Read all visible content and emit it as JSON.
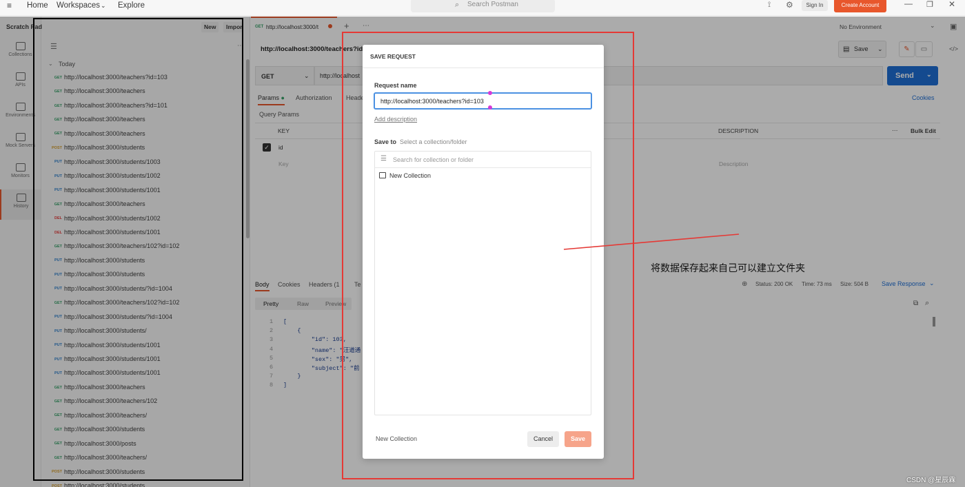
{
  "topbar": {
    "home": "Home",
    "workspaces": "Workspaces",
    "explore": "Explore",
    "search_placeholder": "Search Postman",
    "sign_in": "Sign In",
    "create_account": "Create Account"
  },
  "rail": [
    "Collections",
    "APIs",
    "Environments",
    "Mock Servers",
    "Monitors",
    "History"
  ],
  "sidebar": {
    "title": "Scratch Pad",
    "new_label": "New",
    "import_label": "Impor",
    "group_label": "Today",
    "history": [
      {
        "method": "GET",
        "url": "http://localhost:3000/teachers?id=103"
      },
      {
        "method": "GET",
        "url": "http://localhost:3000/teachers"
      },
      {
        "method": "GET",
        "url": "http://localhost:3000/teachers?id=101"
      },
      {
        "method": "GET",
        "url": "http://localhost:3000/teachers"
      },
      {
        "method": "GET",
        "url": "http://localhost:3000/teachers"
      },
      {
        "method": "POST",
        "url": "http://localhost:3000/students"
      },
      {
        "method": "PUT",
        "url": "http://localhost:3000/students/1003"
      },
      {
        "method": "PUT",
        "url": "http://localhost:3000/students/1002"
      },
      {
        "method": "PUT",
        "url": "http://localhost:3000/students/1001"
      },
      {
        "method": "GET",
        "url": "http://localhost:3000/teachers"
      },
      {
        "method": "DEL",
        "url": "http://localhost:3000/students/1002"
      },
      {
        "method": "DEL",
        "url": "http://localhost:3000/students/1001"
      },
      {
        "method": "GET",
        "url": "http://localhost:3000/teachers/102?id=102"
      },
      {
        "method": "PUT",
        "url": "http://localhost:3000/students"
      },
      {
        "method": "PUT",
        "url": "http://localhost:3000/students"
      },
      {
        "method": "PUT",
        "url": "http://localhost:3000/students/?id=1004"
      },
      {
        "method": "GET",
        "url": "http://localhost:3000/teachers/102?id=102"
      },
      {
        "method": "PUT",
        "url": "http://localhost:3000/students/?id=1004"
      },
      {
        "method": "PUT",
        "url": "http://localhost:3000/students/"
      },
      {
        "method": "PUT",
        "url": "http://localhost:3000/students/1001"
      },
      {
        "method": "PUT",
        "url": "http://localhost:3000/students/1001"
      },
      {
        "method": "PUT",
        "url": "http://localhost:3000/students/1001"
      },
      {
        "method": "GET",
        "url": "http://localhost:3000/teachers"
      },
      {
        "method": "GET",
        "url": "http://localhost:3000/teachers/102"
      },
      {
        "method": "GET",
        "url": "http://localhost:3000/teachers/"
      },
      {
        "method": "GET",
        "url": "http://localhost:3000/students"
      },
      {
        "method": "GET",
        "url": "http://localhost:3000/posts"
      },
      {
        "method": "GET",
        "url": "http://localhost:3000/teachers/"
      },
      {
        "method": "POST",
        "url": "http://localhost:3000/students"
      },
      {
        "method": "POST",
        "url": "http://localhost:3000/students"
      }
    ]
  },
  "main": {
    "tab_method": "GET",
    "tab_label": "http://localhost:3000/t",
    "environment": "No Environment",
    "request_title": "http://localhost:3000/teachers?id",
    "save_label": "Save",
    "method": "GET",
    "url_value": "http://localhost",
    "send_label": "Send",
    "req_tabs": [
      "Params",
      "Authorization",
      "Heade"
    ],
    "cookies": "Cookies",
    "query_params": "Query Params",
    "col_key": "KEY",
    "col_description": "DESCRIPTION",
    "bulk_edit": "Bulk Edit",
    "row_key": "id",
    "key_placeholder": "Key",
    "desc_placeholder": "Description",
    "resp_tabs": [
      "Body",
      "Cookies",
      "Headers (1",
      "Te"
    ],
    "status": "Status: 200 OK",
    "time": "Time: 73 ms",
    "size": "Size: 504 B",
    "save_response": "Save Response",
    "body_tabs": [
      "Pretty",
      "Raw",
      "Preview"
    ],
    "code_lines": [
      {
        "n": "1",
        "t": "["
      },
      {
        "n": "2",
        "t": "    {"
      },
      {
        "n": "3",
        "t": "        \"id\": 103,"
      },
      {
        "n": "4",
        "t": "        \"name\": \"汪道通"
      },
      {
        "n": "5",
        "t": "        \"sex\": \"男\","
      },
      {
        "n": "6",
        "t": "        \"subject\": \"前"
      },
      {
        "n": "7",
        "t": "    }"
      },
      {
        "n": "8",
        "t": "]"
      }
    ]
  },
  "modal": {
    "title": "SAVE REQUEST",
    "request_name_label": "Request name",
    "request_name_value": "http://localhost:3000/teachers?id=103",
    "add_description": "Add description",
    "save_to_label": "Save to",
    "save_to_hint": "Select a collection/folder",
    "search_placeholder": "Search for collection or folder",
    "new_collection_item": "New Collection",
    "footer_new_collection": "New Collection",
    "cancel_label": "Cancel",
    "save_label": "Save"
  },
  "annotation": {
    "text": "将数据保存起来自己可以建立文件夹",
    "watermark": "CSDN @星辰霖"
  },
  "colors": {
    "accent": "#e8572c",
    "send": "#1f6fd6",
    "annotation_red": "#e53935"
  }
}
